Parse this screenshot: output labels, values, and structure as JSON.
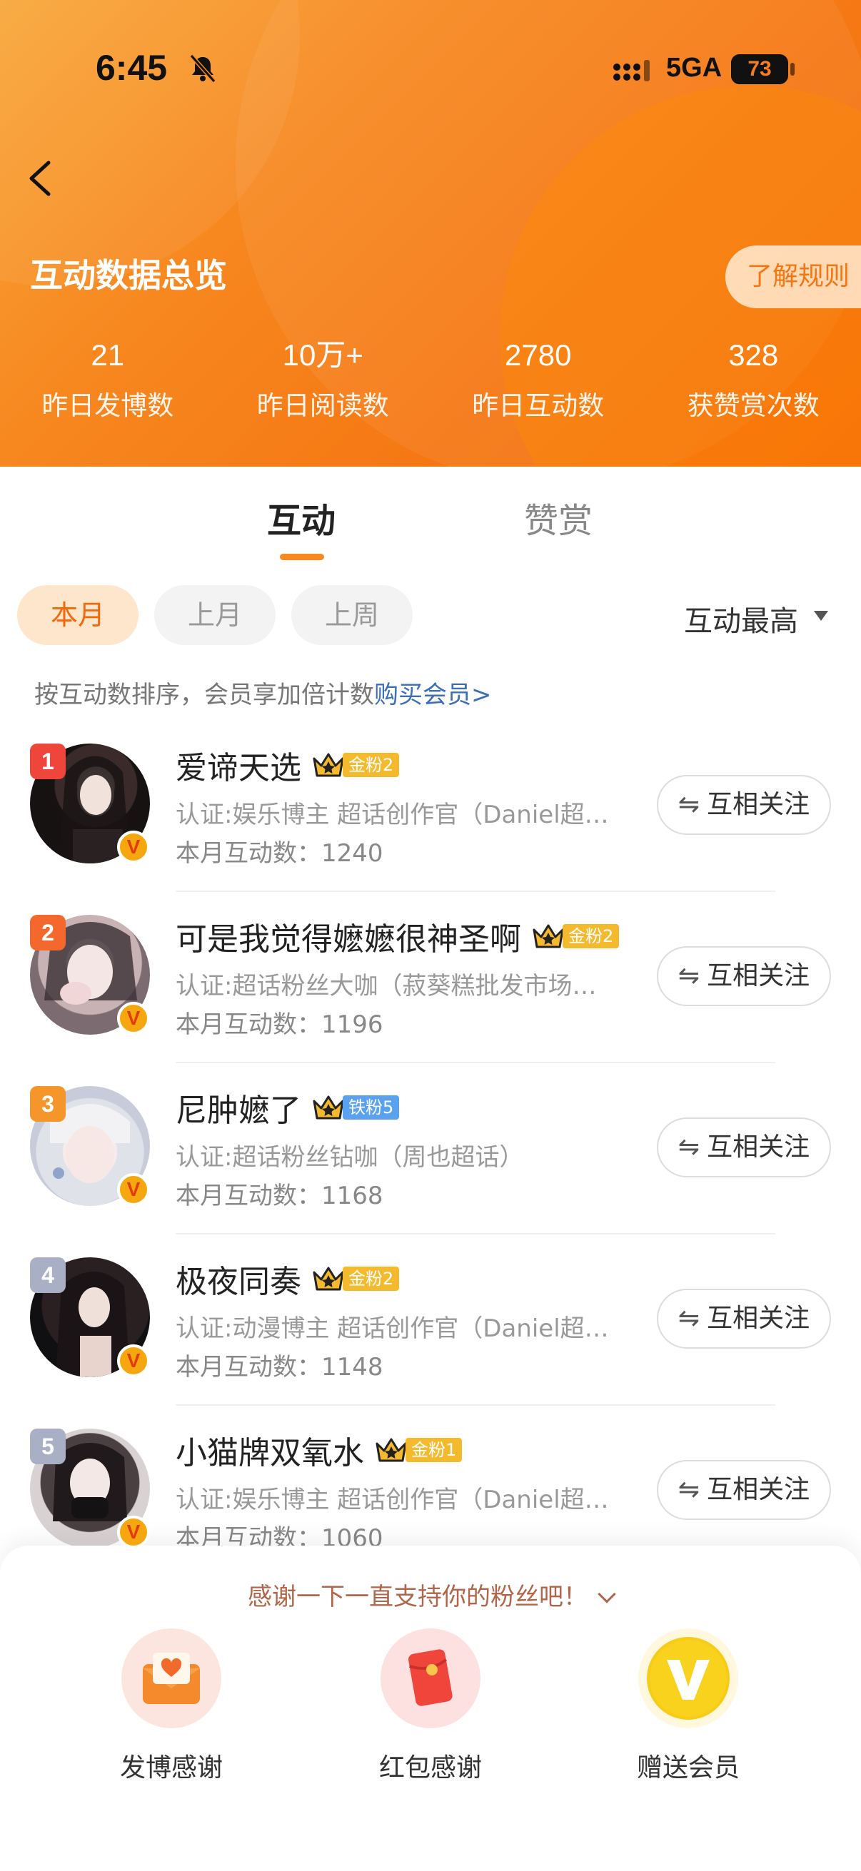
{
  "status_bar": {
    "time": "6:45",
    "network": "5GA",
    "battery": "73",
    "battery_level": 0.73
  },
  "header": {
    "title": "互动数据总览",
    "rules_label": "了解规则",
    "stats": [
      {
        "value": "21",
        "label": "昨日发博数"
      },
      {
        "value": "10万+",
        "label": "昨日阅读数"
      },
      {
        "value": "2780",
        "label": "昨日互动数"
      },
      {
        "value": "328",
        "label": "获赞赏次数"
      }
    ]
  },
  "tabs": {
    "active": "互动",
    "inactive": "赞赏"
  },
  "filters": {
    "chips": [
      "本月",
      "上月",
      "上周"
    ],
    "selected": "本月",
    "sort": "互动最高"
  },
  "hint": {
    "text": "按互动数排序，会员享加倍计数",
    "link": "购买会员>"
  },
  "list": [
    {
      "rank": "1",
      "rank_color": "#f0453a",
      "name": "爱谛天选",
      "fan_level": "金粉2",
      "fan_color": "#f5b92d",
      "verify": "认证:娱乐博主 超话创作官（Daniel超…",
      "count": "本月互动数：1240",
      "follow": "互相关注"
    },
    {
      "rank": "2",
      "rank_color": "#f4682e",
      "name": "可是我觉得嬷嬷很神圣啊",
      "fan_level": "金粉2",
      "fan_color": "#f5b92d",
      "verify": "认证:超话粉丝大咖（菽葵糕批发市场…",
      "count": "本月互动数：1196",
      "follow": "互相关注"
    },
    {
      "rank": "3",
      "rank_color": "#f5962a",
      "name": "尼肿嬷了",
      "fan_level": "铁粉5",
      "fan_color": "#5aa2f0",
      "verify": "认证:超话粉丝钻咖（周也超话）",
      "count": "本月互动数：1168",
      "follow": "互相关注"
    },
    {
      "rank": "4",
      "rank_color": "#a9afc4",
      "name": "极夜同奏",
      "fan_level": "金粉2",
      "fan_color": "#f5b92d",
      "verify": "认证:动漫博主 超话创作官（Daniel超…",
      "count": "本月互动数：1148",
      "follow": "互相关注"
    },
    {
      "rank": "5",
      "rank_color": "#a9afc4",
      "name": "小猫牌双氧水",
      "fan_level": "金粉1",
      "fan_color": "#f5b92d",
      "verify": "认证:娱乐博主 超话创作官（Daniel超…",
      "count": "本月互动数：1060",
      "follow": "互相关注"
    }
  ],
  "sheet": {
    "title": "感谢一下一直支持你的粉丝吧！",
    "actions": [
      {
        "icon": "envelope-heart-icon",
        "label": "发博感谢"
      },
      {
        "icon": "red-packet-icon",
        "label": "红包感谢"
      },
      {
        "icon": "vip-v-icon",
        "label": "赠送会员"
      }
    ]
  }
}
